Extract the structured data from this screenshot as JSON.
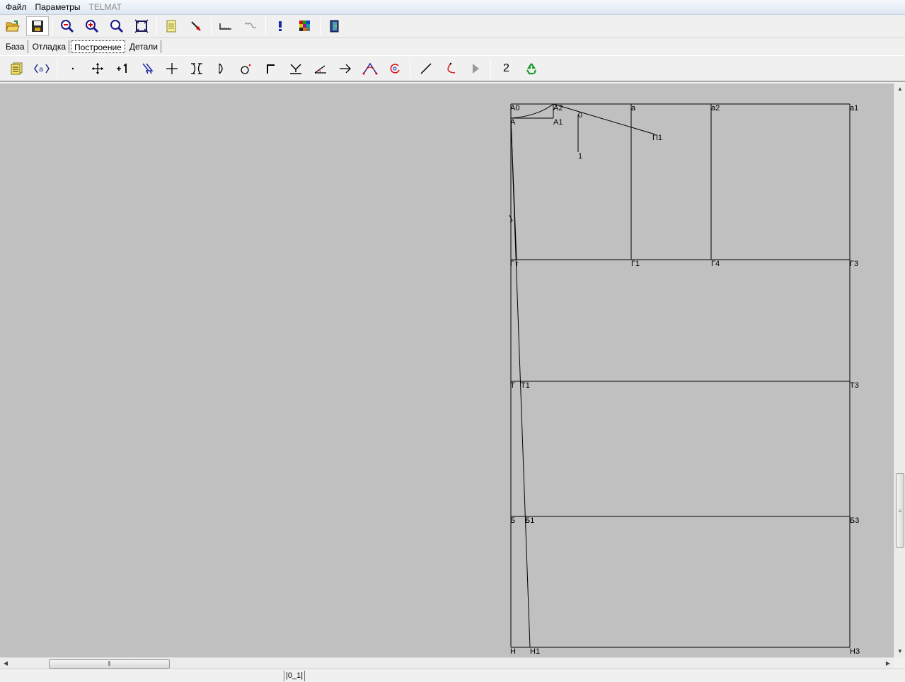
{
  "menu": {
    "file": "Файл",
    "params": "Параметры",
    "app": "TELMAT"
  },
  "tabs": [
    "База",
    "Отладка",
    "Построение",
    "Детали"
  ],
  "toolbar2": {
    "number_label": "2"
  },
  "status": {
    "layer": "|0_1|"
  },
  "drawing": {
    "labels": [
      "А0",
      "А2",
      "А",
      "А1",
      "0",
      "П1",
      "1",
      "а",
      "а2",
      "а1",
      "Г",
      "г",
      "Г1",
      "Г4",
      "Г3",
      "Т",
      "Т1",
      "Т3",
      "Б",
      "Б1",
      "Б3",
      "Н",
      "Н1",
      "Н3"
    ]
  },
  "icons": [
    "open-folder-icon",
    "save-disk-icon",
    "zoom-out-icon",
    "zoom-in-icon",
    "zoom-icon",
    "fit-page-icon",
    "notes-icon",
    "pointer-icon",
    "ruler-icon",
    "ruler-angle-icon",
    "info-icon",
    "palette-icon",
    "exit-icon"
  ]
}
